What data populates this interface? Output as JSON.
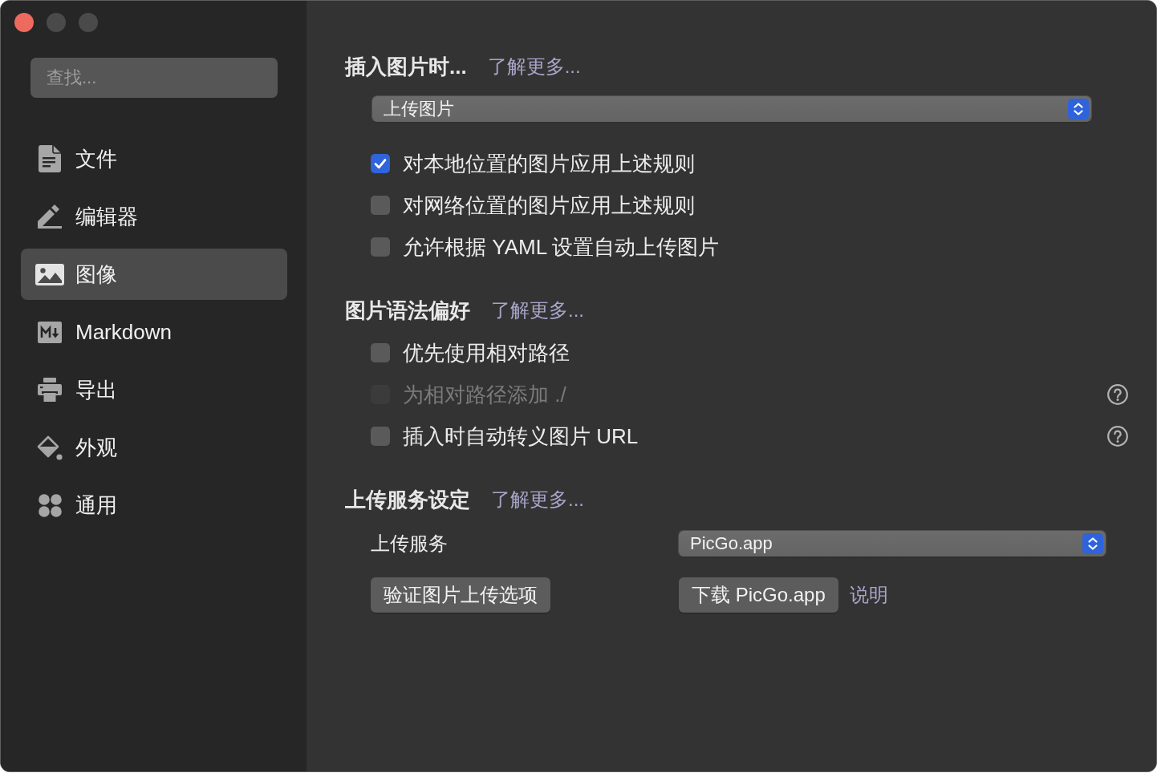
{
  "window": {
    "buttons": [
      {
        "kind": "close",
        "disabled": false
      },
      {
        "kind": "minimize",
        "disabled": true
      },
      {
        "kind": "zoom",
        "disabled": true
      }
    ]
  },
  "sidebar": {
    "search": {
      "placeholder": "查找..."
    },
    "items": [
      {
        "label": "文件",
        "selected": false
      },
      {
        "label": "编辑器",
        "selected": false
      },
      {
        "label": "图像",
        "selected": true
      },
      {
        "label": "Markdown",
        "selected": false
      },
      {
        "label": "导出",
        "selected": false
      },
      {
        "label": "外观",
        "selected": false
      },
      {
        "label": "通用",
        "selected": false
      }
    ]
  },
  "main": {
    "sections": [
      {
        "title": "插入图片时...",
        "link": "了解更多...",
        "rows": [
          {
            "kind": "dropdown",
            "value": "上传图片"
          },
          {
            "kind": "checkbox",
            "label": "对本地位置的图片应用上述规则",
            "checked": true,
            "disabled": false,
            "help": false
          },
          {
            "kind": "checkbox",
            "label": "对网络位置的图片应用上述规则",
            "checked": false,
            "disabled": false,
            "help": false
          },
          {
            "kind": "checkbox",
            "label": "允许根据 YAML 设置自动上传图片",
            "checked": false,
            "disabled": false,
            "help": false
          }
        ]
      },
      {
        "title": "图片语法偏好",
        "link": "了解更多...",
        "rows": [
          {
            "kind": "checkbox",
            "label": "优先使用相对路径",
            "checked": false,
            "disabled": false,
            "help": false
          },
          {
            "kind": "checkbox",
            "label": "为相对路径添加 ./",
            "checked": false,
            "disabled": true,
            "help": true
          },
          {
            "kind": "checkbox",
            "label": "插入时自动转义图片 URL",
            "checked": false,
            "disabled": false,
            "help": true
          }
        ]
      },
      {
        "title": "上传服务设定",
        "link": "了解更多...",
        "rows": [
          {
            "kind": "select",
            "label": "上传服务",
            "value": "PicGo.app"
          },
          {
            "kind": "buttons",
            "left_button": "验证图片上传选项",
            "right_button": "下载 PicGo.app",
            "link": "说明"
          }
        ]
      }
    ]
  }
}
